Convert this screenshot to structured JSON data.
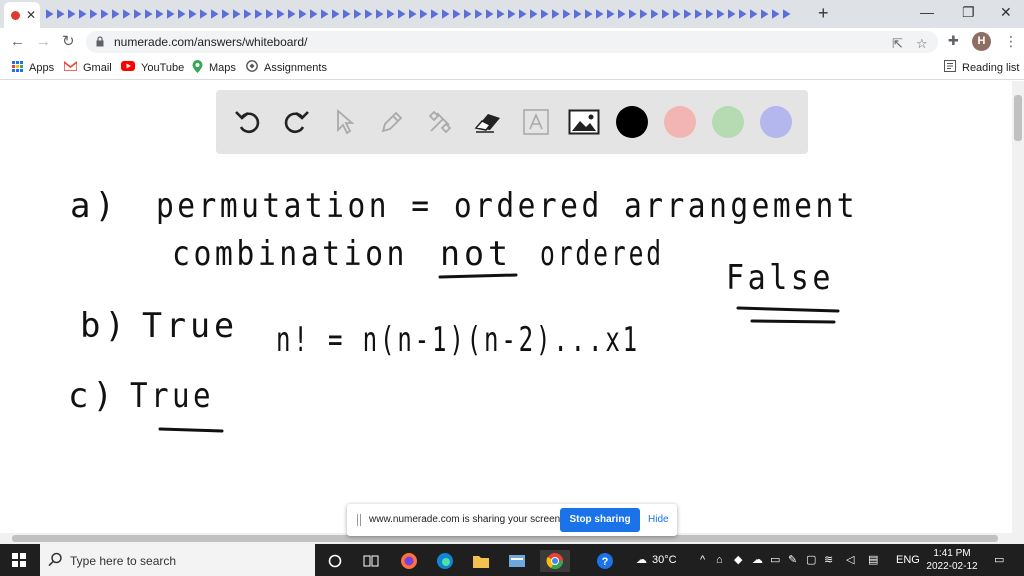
{
  "browser": {
    "tab_close_glyph": "✕",
    "new_tab_glyph": "+",
    "window_controls": {
      "minimize": "—",
      "restore": "❐",
      "close": "✕"
    },
    "url": "numerade.com/answers/whiteboard/",
    "profile_initial": "H",
    "accent_color": "#1a73e8"
  },
  "bookmarks": {
    "items": [
      {
        "label": "Apps",
        "icon": "apps-grid-icon"
      },
      {
        "label": "Gmail",
        "icon": "gmail-icon"
      },
      {
        "label": "YouTube",
        "icon": "youtube-icon"
      },
      {
        "label": "Maps",
        "icon": "maps-icon"
      },
      {
        "label": "Assignments",
        "icon": "assignments-icon"
      }
    ],
    "reading_list": "Reading list"
  },
  "whiteboard": {
    "tools": [
      "undo-icon",
      "redo-icon",
      "select-icon",
      "pen-icon",
      "tools-icon",
      "eraser-icon",
      "text-icon",
      "image-icon"
    ],
    "colors": [
      "#000000",
      "#f2b5b3",
      "#b6dab1",
      "#b3b7ee"
    ],
    "handwriting": {
      "a_label": "a)",
      "a_line1": "permutation = ordered arrangement",
      "a_line2_pre": "combination",
      "a_line2_not": "not",
      "a_line2_post": "ordered",
      "a_answer": "False",
      "b_label": "b)",
      "b_answer": "True",
      "b_formula": "n! = n(n-1)(n-2)...x1",
      "c_label": "c)",
      "c_answer": "True"
    }
  },
  "share_banner": {
    "message": "www.numerade.com is sharing your screen.",
    "stop_label": "Stop sharing",
    "hide_label": "Hide"
  },
  "taskbar": {
    "search_placeholder": "Type here to search",
    "temperature": "30°C",
    "language": "ENG",
    "time": "1:41 PM",
    "date": "2022-02-12"
  }
}
